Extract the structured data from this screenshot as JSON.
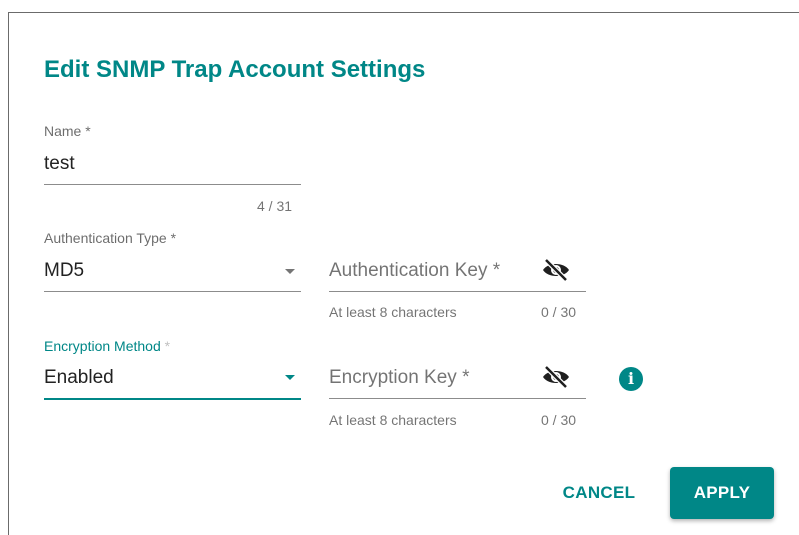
{
  "dialog": {
    "title": "Edit SNMP Trap Account Settings"
  },
  "name_field": {
    "label": "Name *",
    "value": "test",
    "counter": "4 / 31"
  },
  "auth_type_field": {
    "label": "Authentication Type *",
    "value": "MD5",
    "icon": "chevron-down-icon"
  },
  "auth_key_field": {
    "placeholder": "Authentication Key *",
    "hint": "At least 8 characters",
    "counter": "0 / 30",
    "icon": "eye-off-icon"
  },
  "encryption_method_field": {
    "label": "Encryption Method",
    "required_mark": " *",
    "value": "Enabled",
    "icon": "chevron-down-icon"
  },
  "encryption_key_field": {
    "placeholder": "Encryption Key *",
    "hint": "At least 8 characters",
    "counter": "0 / 30",
    "icon": "eye-off-icon",
    "info_icon": "info-icon",
    "info_glyph": "i"
  },
  "actions": {
    "cancel_label": "CANCEL",
    "apply_label": "APPLY"
  },
  "colors": {
    "accent": "#008787",
    "text": "#222222"
  }
}
